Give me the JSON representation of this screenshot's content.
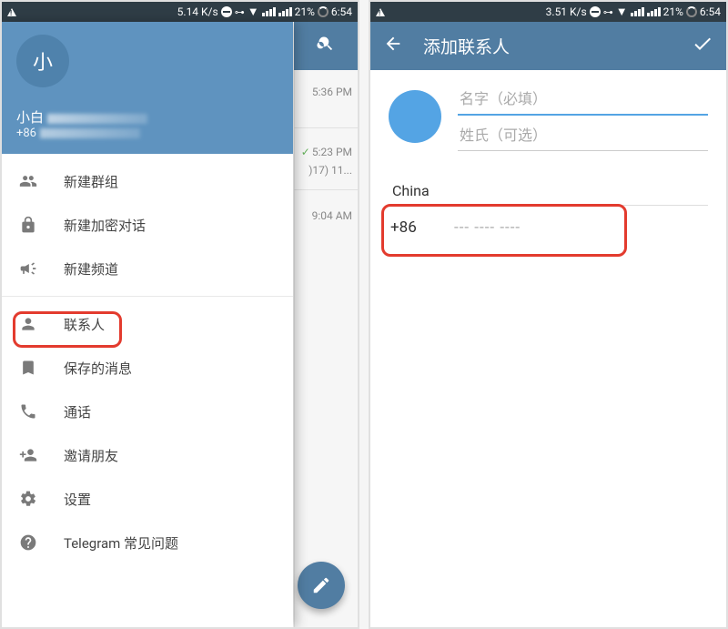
{
  "status": {
    "left_speed": "5.14 K/s",
    "right_speed": "3.51 K/s",
    "battery_pct": "21%",
    "time": "6:54"
  },
  "left": {
    "bg": {
      "t1": "5:36 PM",
      "t2": "5:23 PM",
      "sub2": ")17) 11...",
      "t3": "9:04 AM"
    },
    "drawer": {
      "avatar_initial": "小",
      "name_prefix": "小白",
      "phone_prefix": "+86",
      "items": [
        {
          "label": "新建群组"
        },
        {
          "label": "新建加密对话"
        },
        {
          "label": "新建频道"
        },
        {
          "label": "联系人"
        },
        {
          "label": "保存的消息"
        },
        {
          "label": "通话"
        },
        {
          "label": "邀请朋友"
        },
        {
          "label": "设置"
        },
        {
          "label": "Telegram 常见问题"
        }
      ]
    }
  },
  "right": {
    "title": "添加联系人",
    "first_name_ph": "名字（必填）",
    "last_name_ph": "姓氏（可选）",
    "country": "China",
    "calling_code": "+86",
    "phone_ph": "--- ---- ----"
  }
}
